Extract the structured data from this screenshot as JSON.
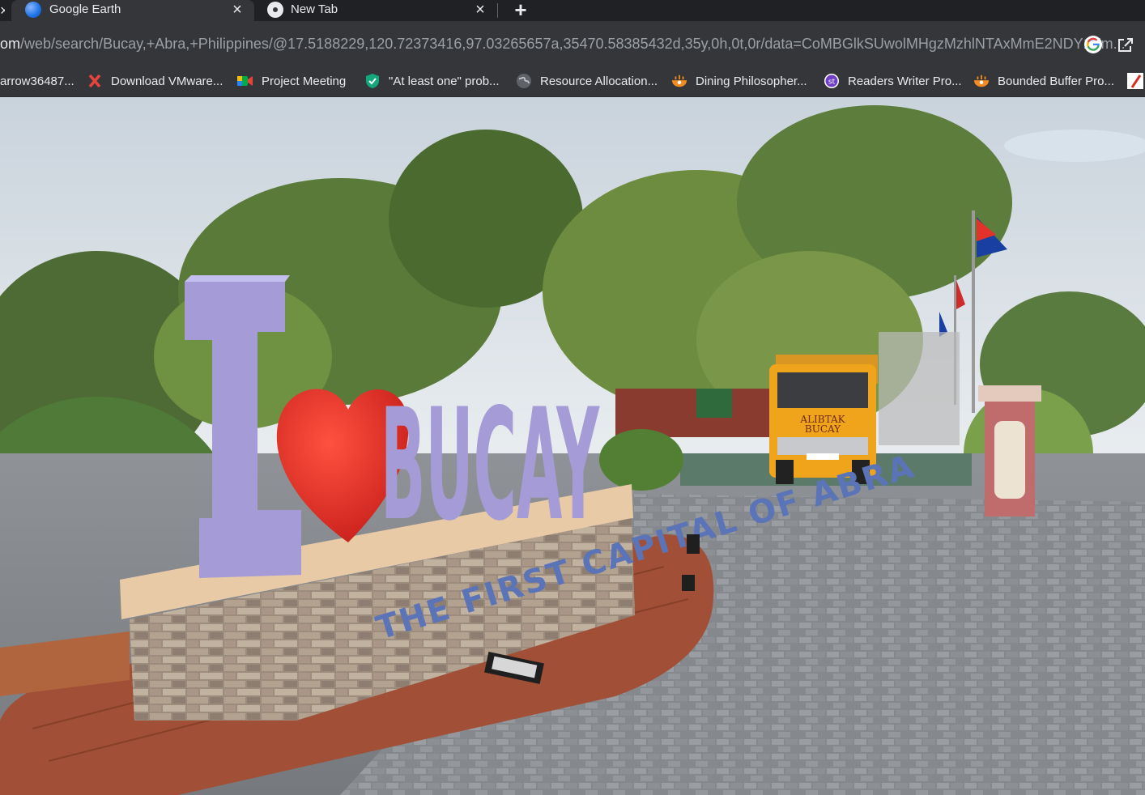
{
  "tabs": [
    {
      "title": "Google Earth",
      "close": "×"
    },
    {
      "title": "New Tab",
      "close": "×"
    }
  ],
  "new_tab_label": "+",
  "address": {
    "host_part": "om",
    "path_part": "/web/search/Bucay,+Abra,+Philippines/@17.5188229,120.72373416,97.03265657a,35470.58385432d,35y,0h,0t,0r/data=CoMBGlkSUwolMHgzMzhlNTAxMmE2NDY1Ym..."
  },
  "bookmarks": [
    {
      "label": "arrow36487..."
    },
    {
      "label": "Download VMware..."
    },
    {
      "label": "Project Meeting"
    },
    {
      "label": "\"At least one\" prob..."
    },
    {
      "label": "Resource Allocation..."
    },
    {
      "label": "Dining Philosopher..."
    },
    {
      "label": "Readers Writer Pro..."
    },
    {
      "label": "Bounded Buffer Pro..."
    }
  ],
  "photo": {
    "sign_text": "I ❤ BUCAY",
    "sign_letters": "BUCAY",
    "sign_subtitle": "THE FIRST CAPITAL OF ABRA",
    "truck_text_1": "ALIBTAK",
    "truck_text_2": "BUCAY"
  },
  "colors": {
    "chrome_dark": "#202124",
    "chrome_toolbar": "#35363a",
    "text": "#e8eaed",
    "sign_lavender": "#a59bd6",
    "heart_red": "#e8322a",
    "truck_yellow": "#f0a41c"
  }
}
